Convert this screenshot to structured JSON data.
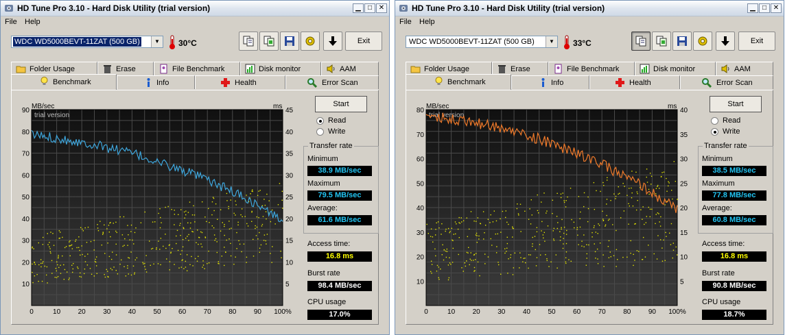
{
  "windows": [
    {
      "title": "HD Tune Pro 3.10 - Hard Disk Utility (trial version)",
      "menu": [
        "File",
        "Help"
      ],
      "drive": "WDC WD5000BEVT-11ZAT (500 GB)",
      "drive_highlighted": true,
      "temperature": "30°C",
      "exit_label": "Exit",
      "tabs_top": [
        "Folder Usage",
        "Erase",
        "File Benchmark",
        "Disk monitor",
        "AAM"
      ],
      "tabs_bottom": [
        "Benchmark",
        "Info",
        "Health",
        "Error Scan"
      ],
      "active_tab": "Benchmark",
      "start_label": "Start",
      "mode_options": [
        "Read",
        "Write"
      ],
      "selected_mode": "Read",
      "transfer_rate_title": "Transfer rate",
      "minimum_label": "Minimum",
      "minimum_value": "38.9 MB/sec",
      "maximum_label": "Maximum",
      "maximum_value": "79.5 MB/sec",
      "average_label": "Average:",
      "average_value": "61.6 MB/sec",
      "access_label": "Access time:",
      "access_value": "16.8 ms",
      "burst_label": "Burst rate",
      "burst_value": "98.4 MB/sec",
      "cpu_label": "CPU usage",
      "cpu_value": "17.0%",
      "chart_data": {
        "type": "line",
        "watermark": "trial version",
        "left_unit": "MB/sec",
        "right_unit": "ms",
        "left_ticks": [
          "90",
          "80",
          "70",
          "60",
          "50",
          "40",
          "30",
          "20",
          "10"
        ],
        "right_ticks": [
          "45",
          "40",
          "35",
          "30",
          "25",
          "20",
          "15",
          "10",
          "5"
        ],
        "x_ticks": [
          "0",
          "10",
          "20",
          "30",
          "40",
          "50",
          "60",
          "70",
          "80",
          "90",
          "100%"
        ],
        "xlim": [
          0,
          100
        ],
        "ylim": [
          0,
          90
        ],
        "y2lim": [
          0,
          45
        ],
        "series": [
          {
            "kind": "line",
            "axis": "left",
            "color": "#3ea6dc",
            "x": [
              0,
              5,
              10,
              15,
              20,
              25,
              30,
              35,
              40,
              45,
              50,
              55,
              60,
              65,
              70,
              75,
              80,
              85,
              90,
              95,
              100
            ],
            "values": [
              78.5,
              77.8,
              77,
              76,
              75,
              74,
              72.5,
              71.5,
              70,
              68,
              66,
              64,
              62,
              60,
              57.5,
              55,
              52.5,
              49.5,
              46,
              42.5,
              39
            ]
          },
          {
            "kind": "scatter",
            "axis": "right",
            "color": "#e6e600",
            "x_range": [
              0,
              100
            ],
            "y_start": [
              5,
              16
            ],
            "y_end": [
              10,
              29
            ]
          }
        ]
      }
    },
    {
      "title": "HD Tune Pro 3.10 - Hard Disk Utility (trial version)",
      "menu": [
        "File",
        "Help"
      ],
      "drive": "WDC WD5000BEVT-11ZAT (500 GB)",
      "drive_highlighted": false,
      "temperature": "33°C",
      "exit_label": "Exit",
      "tabs_top": [
        "Folder Usage",
        "Erase",
        "File Benchmark",
        "Disk monitor",
        "AAM"
      ],
      "tabs_bottom": [
        "Benchmark",
        "Info",
        "Health",
        "Error Scan"
      ],
      "active_tab": "Benchmark",
      "start_label": "Start",
      "mode_options": [
        "Read",
        "Write"
      ],
      "selected_mode": "Write",
      "transfer_rate_title": "Transfer rate",
      "minimum_label": "Minimum",
      "minimum_value": "38.5 MB/sec",
      "maximum_label": "Maximum",
      "maximum_value": "77.8 MB/sec",
      "average_label": "Average:",
      "average_value": "60.8 MB/sec",
      "access_label": "Access time:",
      "access_value": "16.8 ms",
      "burst_label": "Burst rate",
      "burst_value": "90.8 MB/sec",
      "cpu_label": "CPU usage",
      "cpu_value": "18.7%",
      "chart_data": {
        "type": "line",
        "watermark": "trial version",
        "left_unit": "MB/sec",
        "right_unit": "ms",
        "left_ticks": [
          "80",
          "70",
          "60",
          "50",
          "40",
          "30",
          "20",
          "10"
        ],
        "right_ticks": [
          "40",
          "35",
          "30",
          "25",
          "20",
          "15",
          "10",
          "5"
        ],
        "x_ticks": [
          "0",
          "10",
          "20",
          "30",
          "40",
          "50",
          "60",
          "70",
          "80",
          "90",
          "100%"
        ],
        "xlim": [
          0,
          100
        ],
        "ylim": [
          0,
          80
        ],
        "y2lim": [
          0,
          40
        ],
        "series": [
          {
            "kind": "line",
            "axis": "left",
            "color": "#f07a2a",
            "x": [
              0,
              5,
              10,
              15,
              20,
              25,
              30,
              35,
              40,
              45,
              50,
              55,
              60,
              65,
              70,
              75,
              80,
              85,
              90,
              95,
              100
            ],
            "values": [
              77.5,
              77,
              76.5,
              75.5,
              74.5,
              73.5,
              72.5,
              71,
              69.5,
              68,
              66,
              64,
              62,
              60,
              57.5,
              55,
              52,
              49.5,
              46,
              42.5,
              39
            ]
          },
          {
            "kind": "scatter",
            "axis": "right",
            "color": "#e6e600",
            "x_range": [
              0,
              100
            ],
            "y_start": [
              5,
              17
            ],
            "y_end": [
              9,
              30
            ]
          }
        ]
      }
    }
  ]
}
